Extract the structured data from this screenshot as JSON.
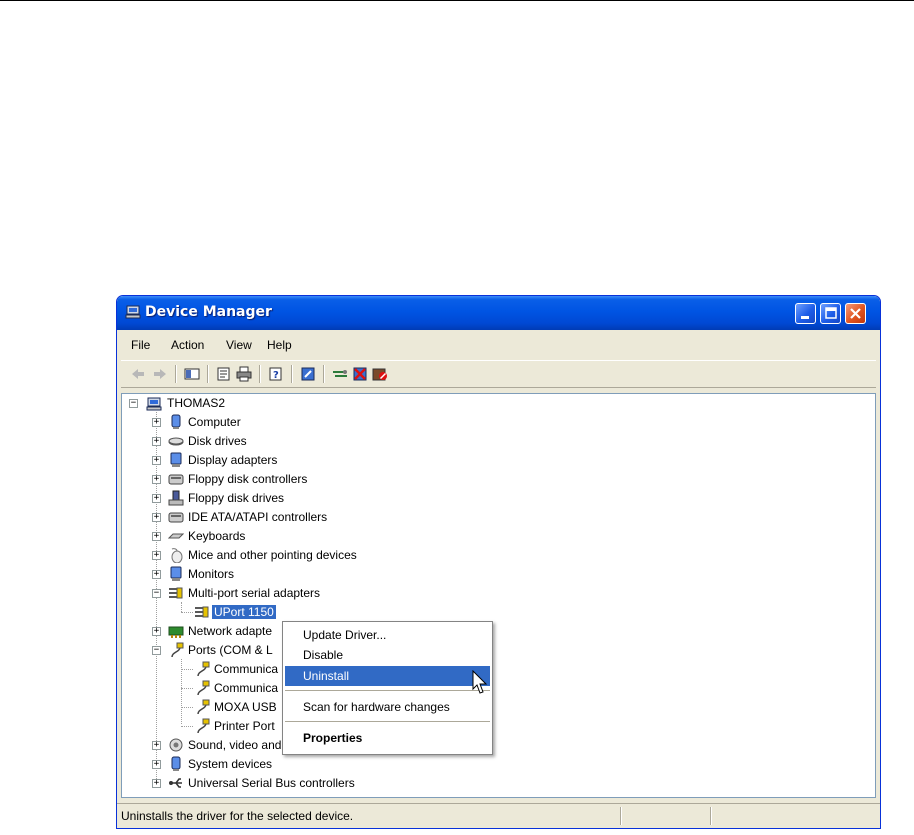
{
  "window": {
    "title": "Device Manager"
  },
  "menubar": {
    "items": [
      "File",
      "Action",
      "View",
      "Help"
    ]
  },
  "toolbar": {
    "buttons": [
      "back-icon",
      "forward-icon",
      "show-hide-tree-icon",
      "properties-icon",
      "print-icon",
      "help-icon",
      "update-driver-icon",
      "scan-hardware-icon",
      "uninstall-icon",
      "disable-icon"
    ]
  },
  "tree": {
    "root": "THOMAS2",
    "items": [
      "Computer",
      "Disk drives",
      "Display adapters",
      "Floppy disk controllers",
      "Floppy disk drives",
      "IDE ATA/ATAPI controllers",
      "Keyboards",
      "Mice and other pointing devices",
      "Monitors",
      "Multi-port serial adapters",
      "UPort 1150",
      "Network adapte",
      "Ports (COM & L",
      "Communica",
      "Communica",
      "MOXA USB",
      "Printer Port",
      "Sound, video and game controllers",
      "System devices",
      "Universal Serial Bus controllers"
    ]
  },
  "context_menu": {
    "items": [
      "Update Driver...",
      "Disable",
      "Uninstall",
      "Scan for hardware changes",
      "Properties"
    ],
    "highlighted": "Uninstall"
  },
  "status": {
    "text": "Uninstalls the driver for the selected device."
  },
  "colors": {
    "selection": "#316ac5",
    "titlebar": "#0054e3",
    "window_bg": "#ece9d8"
  }
}
